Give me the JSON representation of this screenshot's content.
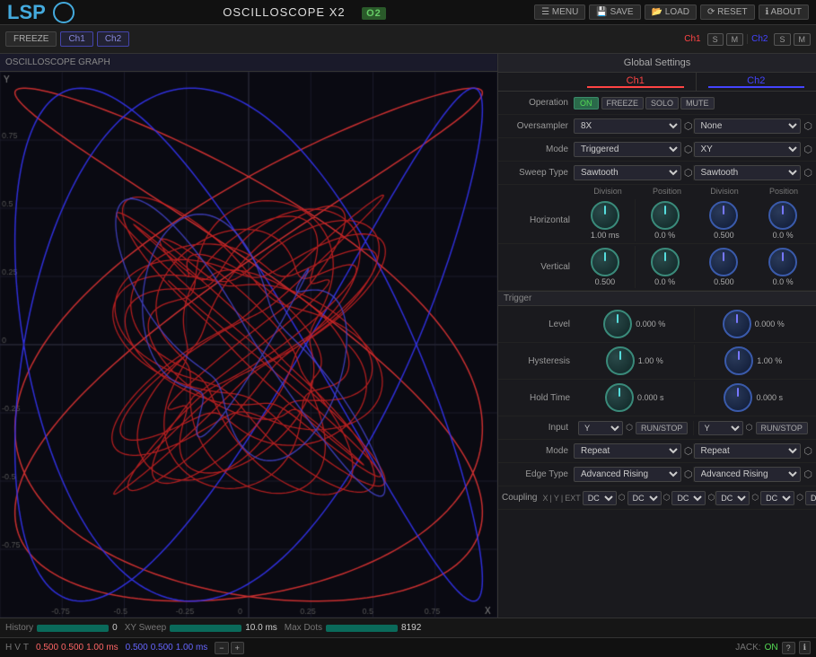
{
  "app": {
    "logo": "LSP",
    "title": "OSCILLOSCOPE X2",
    "badge": "O2"
  },
  "title_buttons": {
    "menu": "☰ MENU",
    "save": "💾 SAVE",
    "load": "📂 LOAD",
    "reset": "⟳ RESET",
    "about": "ℹ ABOUT"
  },
  "toolbar": {
    "freeze": "FREEZE",
    "ch1": "Ch1",
    "ch2": "Ch2",
    "ch1_active": "Ch1",
    "ch2_active": "Ch2",
    "s": "S",
    "m": "M"
  },
  "osc": {
    "header": "OSCILLOSCOPE GRAPH",
    "y_label": "Y",
    "x_label": "X",
    "grid_labels_x": [
      "-0.75",
      "-0.5",
      "-0.25",
      "0",
      "0.25",
      "0.5",
      "0.75"
    ],
    "grid_labels_y": [
      "0.75",
      "0.5",
      "0.25",
      "0",
      "-0.25",
      "-0.5",
      "-0.75"
    ]
  },
  "global_settings": {
    "header": "Global Settings",
    "ch1_label": "Ch1",
    "ch2_label": "Ch2"
  },
  "controls": {
    "operation_label": "Operation",
    "operation_toggle": "ON",
    "freeze_btn": "FREEZE",
    "solo_btn": "SOLO",
    "mute_btn": "MUTE",
    "oversampler_label": "Oversampler",
    "oversampler_ch1": "8X",
    "oversampler_ch2": "None",
    "mode_label": "Mode",
    "mode_ch1": "Triggered",
    "mode_ch2": "XY",
    "sweep_type_label": "Sweep Type",
    "sweep_ch1": "Sawtooth",
    "sweep_ch2": "Sawtooth",
    "div_label": "Division",
    "pos_label": "Position",
    "horizontal_label": "Horizontal",
    "h_div_ch1": "1.00 ms",
    "h_pos_ch1": "0.0 %",
    "h_div_ch2": "0.500",
    "h_pos_ch2": "0.0 %",
    "vertical_label": "Vertical",
    "v_div_ch1": "0.500",
    "v_pos_ch1": "0.0 %",
    "v_div_ch2": "0.500",
    "v_pos_ch2": "0.0 %",
    "trigger_label": "Trigger",
    "level_label": "Level",
    "level_ch1": "0.000 %",
    "level_ch2": "0.000 %",
    "hysteresis_label": "Hysteresis",
    "hys_ch1": "1.00 %",
    "hys_ch2": "1.00 %",
    "hold_time_label": "Hold Time",
    "hold_ch1": "0.000 s",
    "hold_ch2": "0.000 s",
    "input_label": "Input",
    "input_ch1": "Y",
    "input_ch2": "Y",
    "run_stop": "RUN/STOP",
    "mode2_label": "Mode",
    "mode2_ch1": "Repeat",
    "mode2_ch2": "Repeat",
    "edge_type_label": "Edge Type",
    "edge_ch1": "Advanced Rising",
    "edge_ch2": "Advanced Rising",
    "coupling_label": "Coupling",
    "coupling_x": "X",
    "coupling_y": "Y",
    "coupling_ext": "EXT",
    "coupling_dc1_x": "DC",
    "coupling_dc1_y": "DC",
    "coupling_dc1_ext": "DC",
    "coupling_dc2_x": "DC",
    "coupling_dc2_y": "DC",
    "coupling_dc2_ext": "DC"
  },
  "bottom_bar": {
    "history_label": "History",
    "history_value": "0",
    "xy_sweep_label": "XY Sweep",
    "xy_sweep_value": "10.0 ms",
    "max_dots_label": "Max Dots",
    "max_dots_value": "8192"
  },
  "footer": {
    "h_label": "H",
    "v_label": "V",
    "t_label": "T",
    "ch1_h": "0.500",
    "ch1_v": "0.500",
    "ch1_t": "1.00 ms",
    "ch2_h": "0.500",
    "ch2_v": "0.500",
    "ch2_t": "1.00 ms",
    "jack_label": "JACK:",
    "jack_status": "ON"
  }
}
